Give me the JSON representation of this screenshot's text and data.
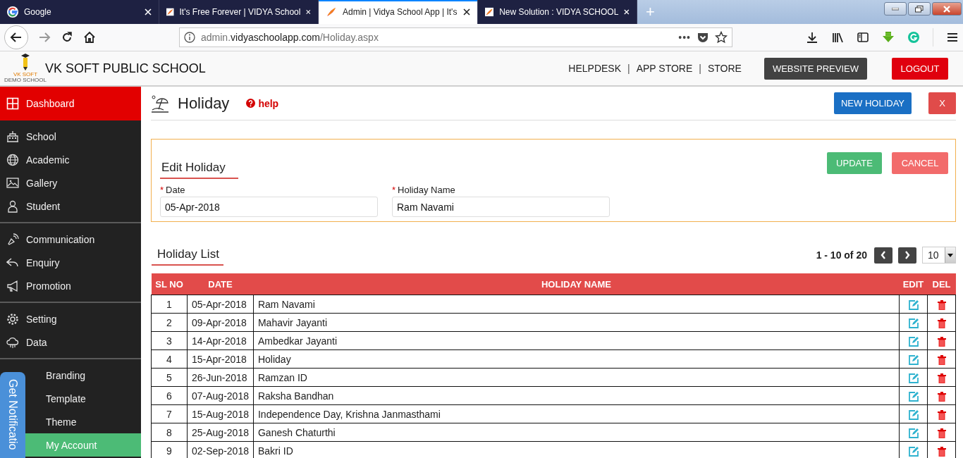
{
  "browser": {
    "tabs": [
      {
        "title": "Google",
        "kind": "google",
        "selected": false
      },
      {
        "title": "It's Free Forever | VIDYA School",
        "kind": "site",
        "selected": false
      },
      {
        "title": "Admin | Vidya School App | It's",
        "kind": "site",
        "selected": true
      },
      {
        "title": "New Solution : VIDYA SCHOOL",
        "kind": "site",
        "selected": false
      }
    ],
    "new_tab": "+",
    "url": {
      "prefix": "admin.",
      "domain": "vidyaschoolapp.com",
      "path": "/Holiday.aspx"
    },
    "page_actions": "•••"
  },
  "header": {
    "logo_lines": [
      "VK SOFT",
      "DEMO SCHOOL"
    ],
    "school_name": "VK SOFT PUBLIC SCHOOL",
    "nav": [
      {
        "kind": "link",
        "text": "HELPDESK"
      },
      {
        "kind": "separator",
        "text": "|"
      },
      {
        "kind": "link",
        "text": "APP STORE"
      },
      {
        "kind": "separator",
        "text": "|"
      },
      {
        "kind": "link",
        "text": "STORE"
      }
    ],
    "preview_button": "WEBSITE PREVIEW",
    "logout_button": "LOGOUT"
  },
  "sidebar": {
    "groups": [
      {
        "items": [
          {
            "label": "Dashboard",
            "selected": true,
            "hovered": false
          }
        ]
      },
      {
        "items": [
          {
            "label": "School",
            "selected": false,
            "hovered": false
          },
          {
            "label": "Academic",
            "selected": false,
            "hovered": false
          },
          {
            "label": "Gallery",
            "selected": false,
            "hovered": false
          },
          {
            "label": "Student",
            "selected": false,
            "hovered": false
          }
        ]
      },
      {
        "items": [
          {
            "label": "Communication",
            "selected": false,
            "hovered": false
          },
          {
            "label": "Enquiry",
            "selected": false,
            "hovered": false
          },
          {
            "label": "Promotion",
            "selected": false,
            "hovered": false
          }
        ]
      },
      {
        "items": [
          {
            "label": "Setting",
            "selected": false,
            "hovered": false
          },
          {
            "label": "Data",
            "selected": false,
            "hovered": false
          }
        ]
      },
      {
        "items": [
          {
            "label": "Branding",
            "selected": false,
            "hovered": false
          },
          {
            "label": "Template",
            "selected": false,
            "hovered": false
          },
          {
            "label": "Theme",
            "selected": false,
            "hovered": false
          },
          {
            "label": "My Account",
            "selected": false,
            "hovered": true
          }
        ]
      }
    ]
  },
  "notification_tab": {
    "label": "Get Notificatio"
  },
  "page": {
    "title": "Holiday",
    "help": "help",
    "new_button": "NEW HOLIDAY",
    "close_button": "X",
    "form": {
      "title": "Edit Holiday",
      "fields": [
        {
          "marker": "*",
          "label": "Date",
          "value": "05-Apr-2018"
        },
        {
          "marker": "*",
          "label": "Holiday Name",
          "value": "Ram Navami"
        }
      ],
      "update_button": "UPDATE",
      "cancel_button": "CANCEL"
    },
    "list": {
      "title": "Holiday List",
      "range": "1 - 10 of 20",
      "page_size": "10",
      "columns": [
        "SL NO",
        "DATE",
        "HOLIDAY NAME",
        "EDIT",
        "DEL"
      ],
      "rows": [
        {
          "sl": "1",
          "date": "05-Apr-2018",
          "name": "Ram Navami"
        },
        {
          "sl": "2",
          "date": "09-Apr-2018",
          "name": "Mahavir Jayanti"
        },
        {
          "sl": "3",
          "date": "14-Apr-2018",
          "name": "Ambedkar Jayanti"
        },
        {
          "sl": "4",
          "date": "15-Apr-2018",
          "name": "Holiday"
        },
        {
          "sl": "5",
          "date": "26-Jun-2018",
          "name": "Ramzan ID"
        },
        {
          "sl": "6",
          "date": "07-Aug-2018",
          "name": "Raksha Bandhan"
        },
        {
          "sl": "7",
          "date": "15-Aug-2018",
          "name": "Independence Day, Krishna Janmasthami"
        },
        {
          "sl": "8",
          "date": "25-Aug-2018",
          "name": "Ganesh Chaturthi"
        },
        {
          "sl": "9",
          "date": "02-Sep-2018",
          "name": "Bakri ID"
        }
      ]
    }
  }
}
